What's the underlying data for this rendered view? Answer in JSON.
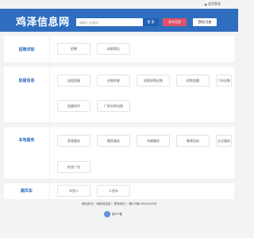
{
  "topbar": {
    "login_link": "会员登录"
  },
  "header": {
    "logo": "鸡泽信息网",
    "search_placeholder": "请输入关键词",
    "search_button": "搜 索",
    "post_button": "发布信息",
    "login_button": "登陆/注册"
  },
  "sections": [
    {
      "title": "招聘求职",
      "items": [
        "招聘",
        "求职简历"
      ]
    },
    {
      "title": "房屋信息",
      "items": [
        "出租房屋",
        "出售房屋",
        "求租求购出售",
        "门市出租转让",
        "门市出售",
        "招商加盟",
        "加盟合作",
        "厂房仓库出租"
      ]
    },
    {
      "title": "本地服务",
      "items": [
        "家政服务",
        "搬家服务",
        "车辆服务",
        "物品买卖",
        "教育培训",
        "企业服务",
        "综合广告"
      ]
    },
    {
      "title": "顺风车",
      "items": [
        "车找人",
        "人找车"
      ]
    }
  ],
  "footer": {
    "links": [
      "网站首页",
      "海报站信息",
      "联系我们",
      "冀ICP备19004326号"
    ],
    "badge_text": "冀ICP备"
  },
  "colors": {
    "brand": "#2f6dbf",
    "accent": "#e0516a",
    "search_button": "#1e5eb3"
  }
}
